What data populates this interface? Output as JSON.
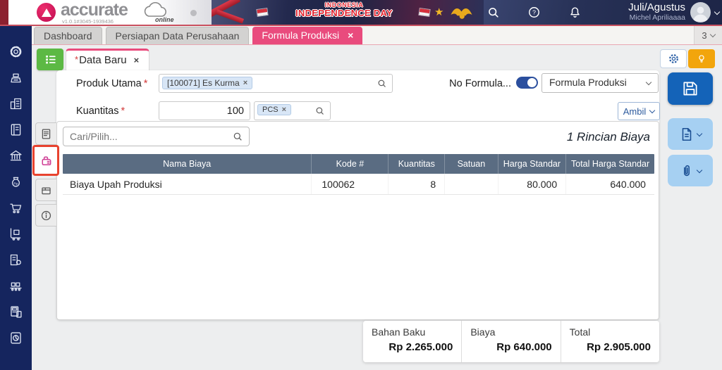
{
  "icon_glyphs": {
    "close": "×",
    "star": "★",
    "dirty_marker": "*",
    "required_marker": "*"
  },
  "header": {
    "brand": "accurate",
    "version": "v1.0.1#3045-1939436",
    "online_label": "online",
    "banner": {
      "line1": "INDONESIA",
      "line2": "INDEPENDENCE DAY"
    },
    "toolbar_icons": [
      "search",
      "help",
      "notifications"
    ],
    "user": {
      "period": "Juli/Agustus",
      "name": "Michel Apriliaaaa"
    }
  },
  "tabbar": {
    "tabs": [
      {
        "label": "Dashboard",
        "active": false
      },
      {
        "label": "Persiapan Data Perusahaan",
        "active": false
      },
      {
        "label": "Formula Produksi",
        "active": true
      }
    ],
    "overflow_count": "3"
  },
  "sidebar": {
    "icons": [
      "settings",
      "cash-register",
      "company",
      "journal",
      "bank",
      "sales",
      "purchase",
      "inventory",
      "asset",
      "manufacture",
      "tax",
      "report"
    ]
  },
  "side_tabs": {
    "items": [
      "note",
      "cost",
      "package",
      "info"
    ],
    "active": "cost"
  },
  "workspace": {
    "doc_tab": {
      "label": "Data Baru"
    },
    "form": {
      "produk_utama": {
        "label": "Produk Utama",
        "chip": "[100071] Es Kurma"
      },
      "kuantitas": {
        "label": "Kuantitas",
        "value": "100",
        "unit_chip": "PCS"
      },
      "no_formula_label": "No Formula...",
      "formula_type_value": "Formula Produksi",
      "ambil_label": "Ambil"
    },
    "detail": {
      "search_placeholder": "Cari/Pilih...",
      "counter": "1 Rincian Biaya",
      "columns": [
        "Nama Biaya",
        "Kode #",
        "Kuantitas",
        "Satuan",
        "Harga Standar",
        "Total Harga Standar"
      ],
      "rows": [
        {
          "nama": "Biaya Upah Produksi",
          "kode": "100062",
          "kuantitas": "8",
          "satuan": "",
          "harga": "80.000",
          "total": "640.000"
        }
      ]
    },
    "summary": [
      {
        "label": "Bahan Baku",
        "value": "Rp 2.265.000"
      },
      {
        "label": "Biaya",
        "value": "Rp 640.000"
      },
      {
        "label": "Total",
        "value": "Rp 2.905.000"
      }
    ]
  }
}
